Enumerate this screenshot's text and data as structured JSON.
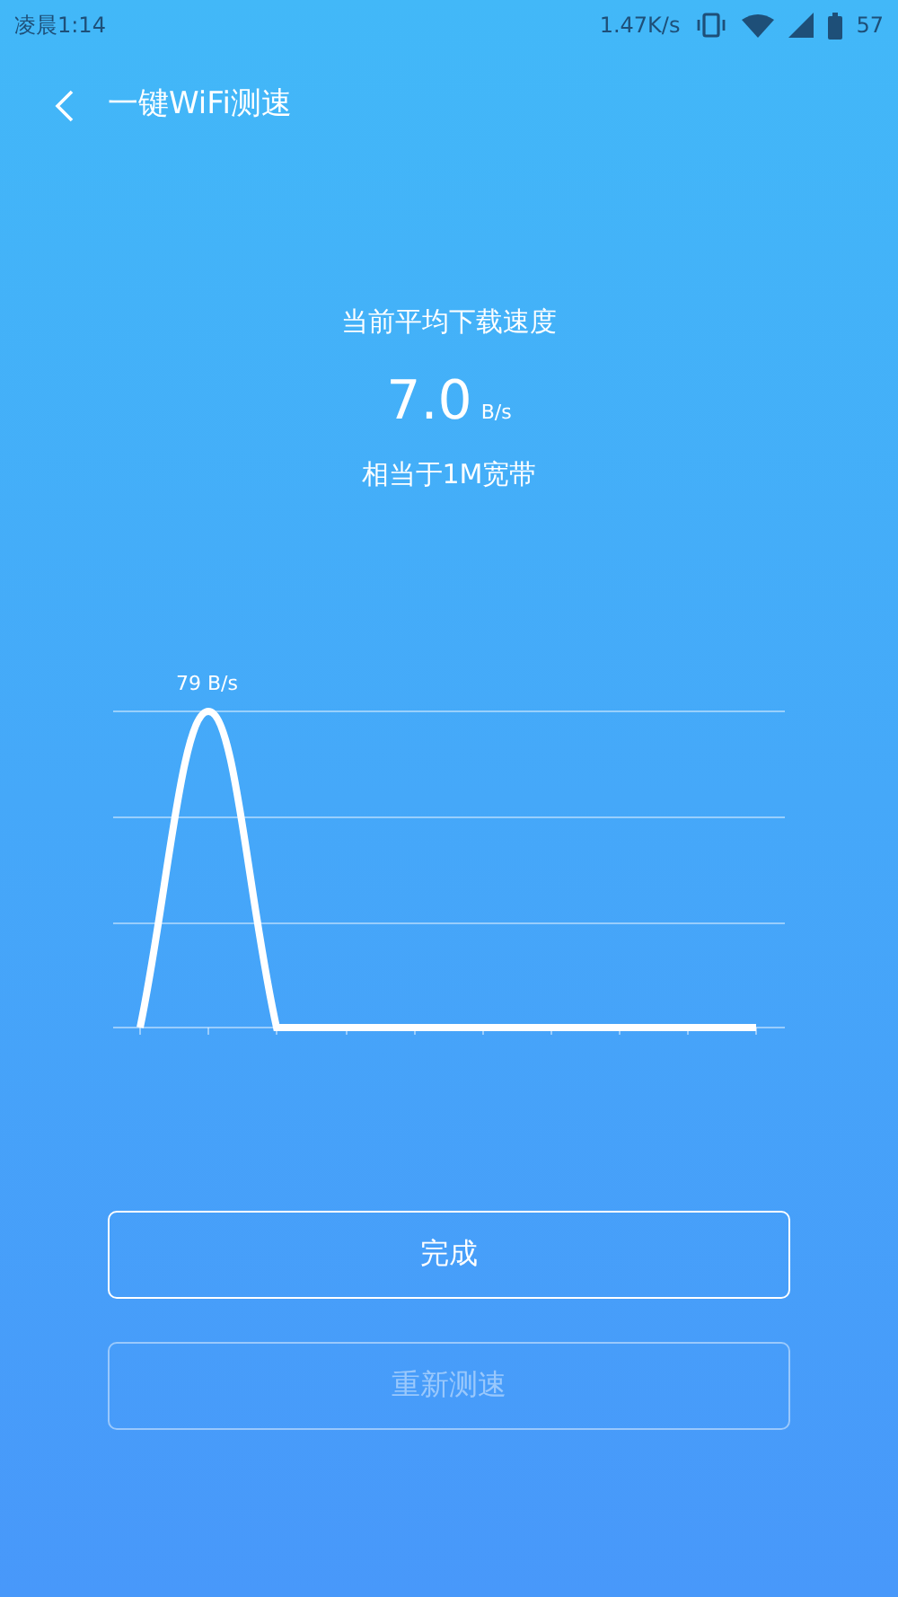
{
  "status_bar": {
    "time": "凌晨1:14",
    "net_speed": "1.47K/s",
    "battery": "57"
  },
  "header": {
    "title": "一键WiFi测速"
  },
  "result": {
    "caption": "当前平均下载速度",
    "value": "7.0",
    "unit": "B/s",
    "equivalent": "相当于1M宽带"
  },
  "graph": {
    "peak_label": "79 B/s"
  },
  "buttons": [
    {
      "label": "完成",
      "disabled": false
    },
    {
      "label": "重新测速",
      "disabled": true
    }
  ]
}
